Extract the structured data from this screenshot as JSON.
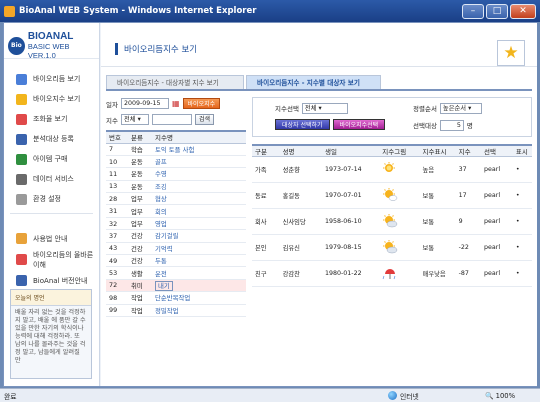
{
  "window": {
    "title": "BioAnal WEB System - Windows Internet Explorer",
    "min": "–",
    "max": "□",
    "close": "✕"
  },
  "logo": {
    "badge": "Bio",
    "name": "BIOANAL",
    "sub": "BASIC WEB VER.1.0"
  },
  "menu": [
    {
      "label": "바이오리듬 보기",
      "icon": "chart-icon",
      "color": "#4a7ed8"
    },
    {
      "label": "바이오지수 보기",
      "icon": "star-icon",
      "color": "#f2b51c"
    },
    {
      "label": "조화율 보기",
      "icon": "heart-icon",
      "color": "#e04a4a"
    },
    {
      "label": "분석대상 등록",
      "icon": "user-icon",
      "color": "#3a63ad"
    },
    {
      "label": "아이템 구매",
      "icon": "shield-icon",
      "color": "#2f8f3f"
    },
    {
      "label": "데이터 서비스",
      "icon": "data-icon",
      "color": "#6a6a6a"
    },
    {
      "label": "환경 설정",
      "icon": "gear-icon",
      "color": "#9a9a9a"
    }
  ],
  "menu2": [
    {
      "label": "사용법 안내",
      "icon": "help-icon",
      "color": "#e8a23a"
    },
    {
      "label": "바이오리듬의 올바른 이해",
      "icon": "info-icon",
      "color": "#e04a4a"
    },
    {
      "label": "BioAnal 버전안내",
      "icon": "monitor-icon",
      "color": "#3a63ad"
    }
  ],
  "quote": {
    "title": "오늘의 명언",
    "text": "배울 자리 없는 것을 걱정하지 말고, 배울 에 품만 갈 수 있을 만한 자기의 학식이나 능력에 대해 걱정하라. 또 남의 나를 몰라주는 것을 걱정 말고, 남들에게 알려질 만"
  },
  "page": {
    "title": "바이오리듬지수 보기"
  },
  "tabs": [
    {
      "label": "바이오리듬지수 - 대상자별 지수 보기"
    },
    {
      "label": "바이오리듬지수 - 지수별 대상자 보기"
    }
  ],
  "filters": {
    "date_label": "일자",
    "date_value": "2009-09-15",
    "date_button": "바이오지수",
    "index_label": "지수",
    "index_select": "전체",
    "search_button": "검색"
  },
  "left_table": {
    "headers": [
      "번호",
      "분류",
      "지수명"
    ],
    "rows": [
      [
        "7",
        "학습",
        "토익 토플 사험"
      ],
      [
        "10",
        "운동",
        "골프"
      ],
      [
        "11",
        "운동",
        "수영"
      ],
      [
        "13",
        "운동",
        "조깅"
      ],
      [
        "28",
        "업무",
        "협상"
      ],
      [
        "31",
        "업무",
        "회의"
      ],
      [
        "32",
        "업무",
        "영업"
      ],
      [
        "37",
        "건강",
        "감기걸릴"
      ],
      [
        "43",
        "건강",
        "기억력"
      ],
      [
        "49",
        "건강",
        "두통"
      ],
      [
        "53",
        "생활",
        "운전"
      ],
      [
        "72",
        "취미",
        "내기"
      ],
      [
        "98",
        "작업",
        "단순반복작업"
      ],
      [
        "99",
        "작업",
        "정밀작업"
      ]
    ],
    "selected_index": 11
  },
  "right_filters": {
    "select_label": "지수선택",
    "select_value": "전체",
    "sort_label": "정렬순서",
    "sort_value": "높은순서",
    "target_btn": "대상자 선택하기",
    "index_btn": "바이오지수선택",
    "count_label": "선택대상",
    "count_value": "5",
    "count_unit": "명"
  },
  "right_table": {
    "headers": [
      "구분",
      "성명",
      "생일",
      "지수그림",
      "지수표시",
      "지수",
      "선택",
      "표시"
    ],
    "rows": [
      {
        "group": "가족",
        "name": "성춘향",
        "birth": "1973-07-14",
        "weather": "sunny",
        "status": "높음",
        "score": "37",
        "pick": "pearl",
        "mark": "•"
      },
      {
        "group": "동료",
        "name": "홍길동",
        "birth": "1970-07-01",
        "weather": "partly-cloudy",
        "status": "보통",
        "score": "17",
        "pick": "pearl",
        "mark": "•"
      },
      {
        "group": "회사",
        "name": "신사임당",
        "birth": "1958-06-10",
        "weather": "cloudy-sun",
        "status": "보통",
        "score": "9",
        "pick": "pearl",
        "mark": "•"
      },
      {
        "group": "본인",
        "name": "김유신",
        "birth": "1979-08-15",
        "weather": "cloudy-sun",
        "status": "보통",
        "score": "-22",
        "pick": "pearl",
        "mark": "•"
      },
      {
        "group": "친구",
        "name": "강감찬",
        "birth": "1980-01-22",
        "weather": "rain-umbrella",
        "status": "매우낮음",
        "score": "-87",
        "pick": "pearl",
        "mark": "•"
      }
    ]
  },
  "statusbar": {
    "left": "완료",
    "zone": "인터넷",
    "zoom": "100%"
  }
}
